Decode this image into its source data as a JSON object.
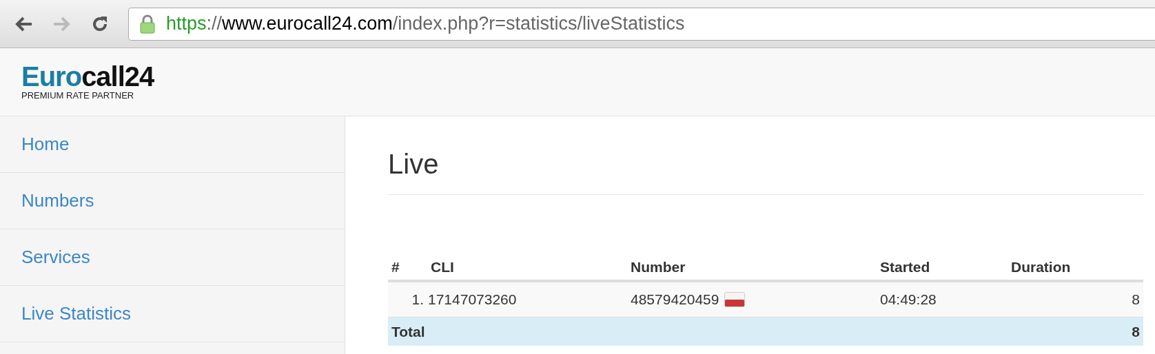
{
  "browser": {
    "url": {
      "scheme": "https",
      "separator": "://",
      "host": "www.eurocall24.com",
      "path": "/index.php?r=statistics/liveStatistics"
    },
    "back_disabled": false,
    "forward_disabled": true
  },
  "logo": {
    "first": "Euro",
    "second": "call24",
    "tagline": "PREMIUM RATE PARTNER"
  },
  "sidebar": {
    "items": [
      {
        "label": "Home",
        "selected": false
      },
      {
        "label": "Numbers",
        "selected": false
      },
      {
        "label": "Services",
        "selected": false
      },
      {
        "label": "Live Statistics",
        "selected": false
      }
    ]
  },
  "page": {
    "title": "Live"
  },
  "table": {
    "columns": [
      "#",
      "CLI",
      "Number",
      "Started",
      "Duration"
    ],
    "rows": [
      {
        "index": "1.",
        "cli": "17147073260",
        "number": "48579420459",
        "started": "04:49:28",
        "duration": "8"
      }
    ],
    "total": {
      "label": "Total",
      "value": "8"
    }
  }
}
